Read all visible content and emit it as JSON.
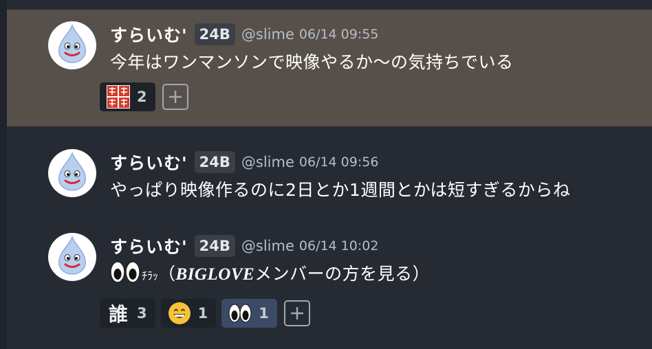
{
  "messages": [
    {
      "display_name": "すらいむ'",
      "badge": "24B",
      "handle": "@slime",
      "time": "06/14 09:55",
      "text": "今年はワンマンソンで映像やるか〜の気持ちでいる",
      "highlighted": true,
      "reactions": [
        {
          "emoji": "kanji-stamp-icon",
          "count": "2"
        }
      ]
    },
    {
      "display_name": "すらいむ'",
      "badge": "24B",
      "handle": "@slime",
      "time": "06/14 09:56",
      "text": "やっぱり映像作るのに2日とか1週間とかは短すぎるからね",
      "highlighted": false,
      "reactions": []
    },
    {
      "display_name": "すらいむ'",
      "badge": "24B",
      "handle": "@slime",
      "time": "06/14 10:02",
      "text_small": "ﾁﾗｯ",
      "text_paren_open": "（",
      "text_bold": "BIGLOVE",
      "text_rest": "メンバーの方を見る）",
      "highlighted": false,
      "reactions": [
        {
          "emoji": "誰",
          "count": "3",
          "icon": "dare-kanji-icon"
        },
        {
          "emoji": "grinning-face-icon",
          "count": "1"
        },
        {
          "emoji": "eyes-icon",
          "count": "1",
          "active": true
        }
      ]
    }
  ],
  "colors": {
    "background": "#252a33",
    "highlight": "#57504a",
    "badge_bg": "#3a3f48",
    "reaction_bg": "#1e2229",
    "reaction_active_bg": "#3b4a66"
  }
}
